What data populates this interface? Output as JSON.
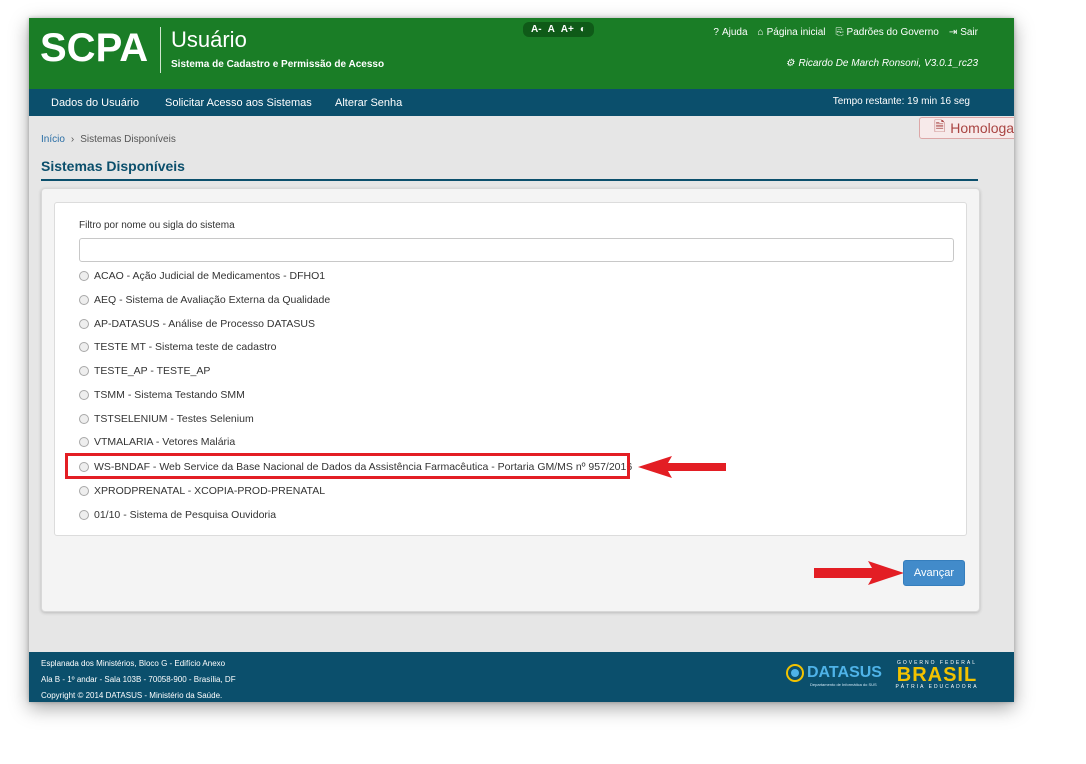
{
  "header": {
    "logo": "SCPA",
    "app_title": "Usuário",
    "app_subtitle": "Sistema de Cadastro e Permissão de Acesso",
    "font_tools": [
      "A-",
      "A",
      "A+",
      "◐"
    ],
    "links": [
      {
        "icon": "?",
        "label": "Ajuda"
      },
      {
        "icon": "⌂",
        "label": "Página inicial"
      },
      {
        "icon": "⎘",
        "label": "Padrões do Governo"
      },
      {
        "icon": "⇥",
        "label": "Sair"
      }
    ],
    "user_info": "Ricardo De March Ronsoni, V3.0.1_rc23",
    "user_icon": "gear-icon"
  },
  "nav": {
    "items": [
      "Dados do Usuário",
      "Solicitar Acesso aos Sistemas",
      "Alterar Senha"
    ],
    "timer": "Tempo restante: 19 min 16 seg"
  },
  "environment_badge": "Homologa",
  "breadcrumb": {
    "home": "Início",
    "separator": "›",
    "current": "Sistemas Disponíveis"
  },
  "page_title": "Sistemas Disponíveis",
  "filter": {
    "label": "Filtro por nome ou sigla do sistema",
    "value": "",
    "placeholder": ""
  },
  "systems": [
    "ACAO - Ação Judicial de Medicamentos - DFHO1",
    "AEQ - Sistema de Avaliação Externa da Qualidade",
    "AP-DATASUS - Análise de Processo DATASUS",
    "TESTE MT - Sistema teste de cadastro",
    "TESTE_AP - TESTE_AP",
    "TSMM - Sistema Testando SMM",
    "TSTSELENIUM - Testes Selenium",
    "VTMALARIA - Vetores Malária",
    "WS-BNDAF - Web Service da Base Nacional de Dados da Assistência Farmacêutica - Portaria GM/MS nº 957/2016",
    "XPRODPRENATAL - XCOPIA-PROD-PRENATAL",
    "01/10 - Sistema de Pesquisa Ouvidoria"
  ],
  "advance_button": "Avançar",
  "annotation_color": "#e31e24",
  "footer": {
    "lines": [
      "Esplanada dos Ministérios, Bloco G - Edifício Anexo",
      "Ala B - 1º andar - Sala 103B - 70058-900 - Brasília, DF",
      "Copyright © 2014 DATASUS - Ministério da Saúde."
    ],
    "datasus": "DATASUS",
    "datasus_sub": "Departamento de Informática do SUS",
    "gov_top": "GOVERNO FEDERAL",
    "brasil": "BRASIL",
    "gov_tag": "PÁTRIA EDUCADORA"
  }
}
